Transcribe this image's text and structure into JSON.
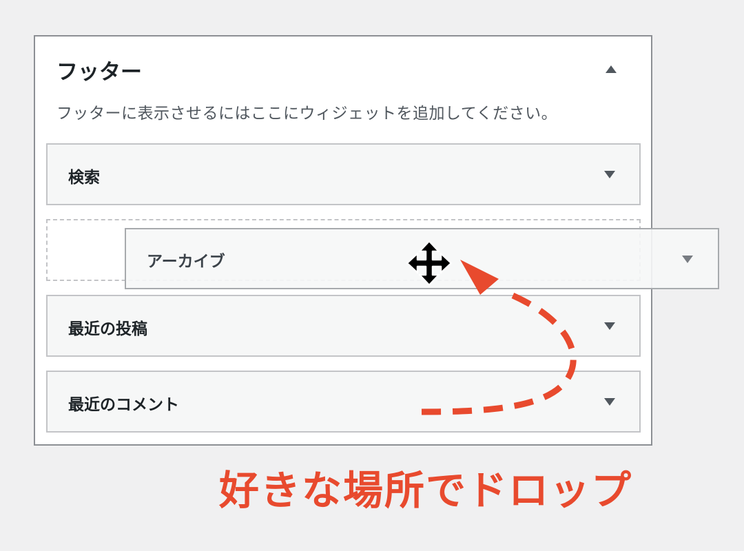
{
  "panel": {
    "title": "フッター",
    "description": "フッターに表示させるにはここにウィジェットを追加してください。"
  },
  "widgets": [
    {
      "title": "検索"
    },
    {
      "title": "最近の投稿"
    },
    {
      "title": "最近のコメント"
    }
  ],
  "dragging_widget": {
    "title": "アーカイブ"
  },
  "annotation": {
    "caption": "好きな場所でドロップ",
    "color": "#e84a2e"
  },
  "icons": {
    "collapse": "triangle-up-icon",
    "expand": "triangle-down-icon",
    "cursor": "move-cursor-icon"
  }
}
